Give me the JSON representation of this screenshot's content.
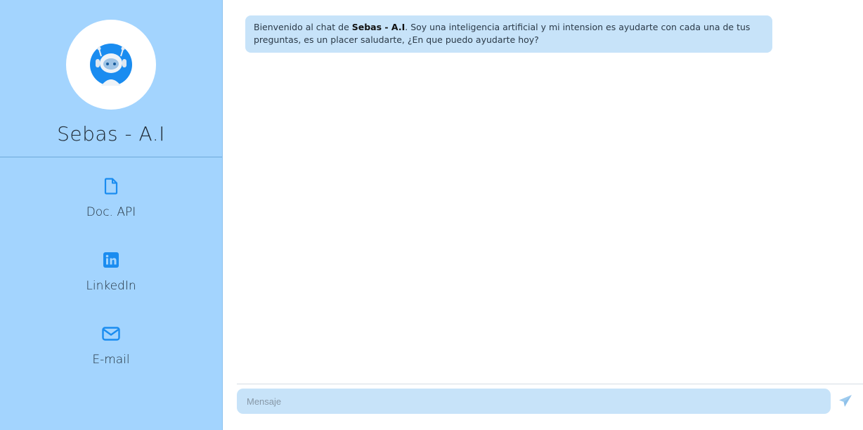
{
  "sidebar": {
    "bot_name": "Sebas - A.I",
    "nav": [
      {
        "label": "Doc. API",
        "icon": "file-icon"
      },
      {
        "label": "LinkedIn",
        "icon": "linkedin-icon"
      },
      {
        "label": "E-mail",
        "icon": "envelope-icon"
      }
    ]
  },
  "chat": {
    "messages": [
      {
        "sender": "bot",
        "pre": "Bienvenido al chat de ",
        "bold": "Sebas - A.I",
        "post": ". Soy una inteligencia artificial y mi intension es ayudarte con cada una de tus preguntas, es un placer saludarte, ¿En que puedo ayudarte hoy?"
      }
    ],
    "composer": {
      "placeholder": "Mensaje",
      "send_icon": "send-icon"
    }
  },
  "colors": {
    "sidebar_bg": "#a3d4fe",
    "bubble_bg": "#c7e3f9",
    "accent": "#1a8cf0"
  }
}
